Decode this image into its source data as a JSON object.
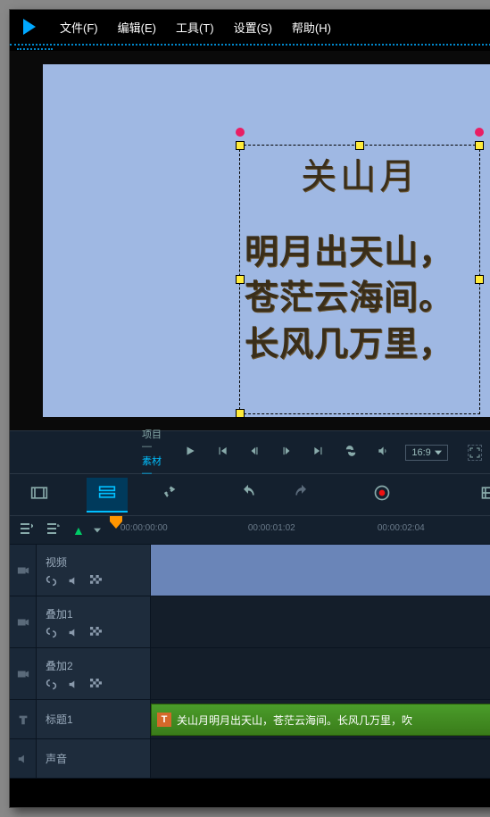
{
  "menu": {
    "file": "文件(F)",
    "edit": "编辑(E)",
    "tools": "工具(T)",
    "settings": "设置(S)",
    "help": "帮助(H)"
  },
  "preview": {
    "title": "关山月",
    "poem_lines": [
      "明月出天山，",
      "苍茫云海间。",
      "长风几万里，"
    ]
  },
  "controls": {
    "project": "项目—",
    "material": "素材—",
    "ratio": "16:9"
  },
  "ruler": {
    "t0": "00:00:00:00",
    "t1": "00:00:01:02",
    "t2": "00:00:02:04"
  },
  "tracks": {
    "video": "视频",
    "overlay1": "叠加1",
    "overlay2": "叠加2",
    "title1": "标题1",
    "audio": "声音"
  },
  "clip": {
    "title_marker": "T",
    "title_text": "关山月明月出天山，苍茫云海间。长风几万里，吹"
  }
}
